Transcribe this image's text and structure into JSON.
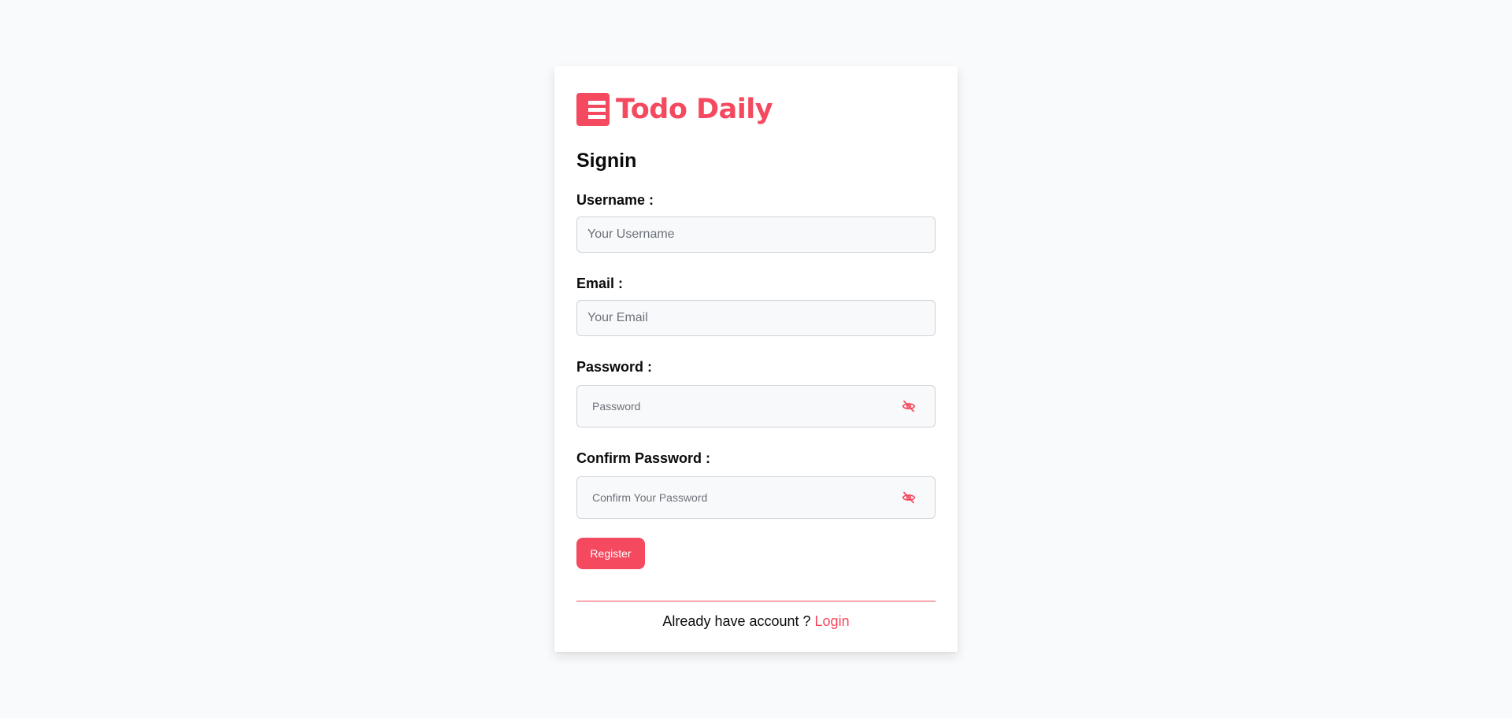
{
  "brand": {
    "name": "Todo Daily",
    "logo_icon": "list-icon",
    "color": "#f4495e"
  },
  "form": {
    "heading": "Signin",
    "username": {
      "label": "Username :",
      "placeholder": "Your Username",
      "value": ""
    },
    "email": {
      "label": "Email :",
      "placeholder": "Your Email",
      "value": ""
    },
    "password": {
      "label": "Password :",
      "placeholder": "Password",
      "value": "",
      "toggle_icon": "eye-off-icon"
    },
    "confirm_password": {
      "label": "Confirm Password :",
      "placeholder": "Confirm Your Password",
      "value": "",
      "toggle_icon": "eye-off-icon"
    },
    "submit_label": "Register"
  },
  "footer": {
    "prompt": "Already have account ? ",
    "link_label": "Login"
  },
  "colors": {
    "accent": "#f4495e",
    "page_background": "#f9fafb",
    "card_background": "#ffffff",
    "input_background": "#f8f9fa",
    "input_border": "#cfd3d8"
  }
}
